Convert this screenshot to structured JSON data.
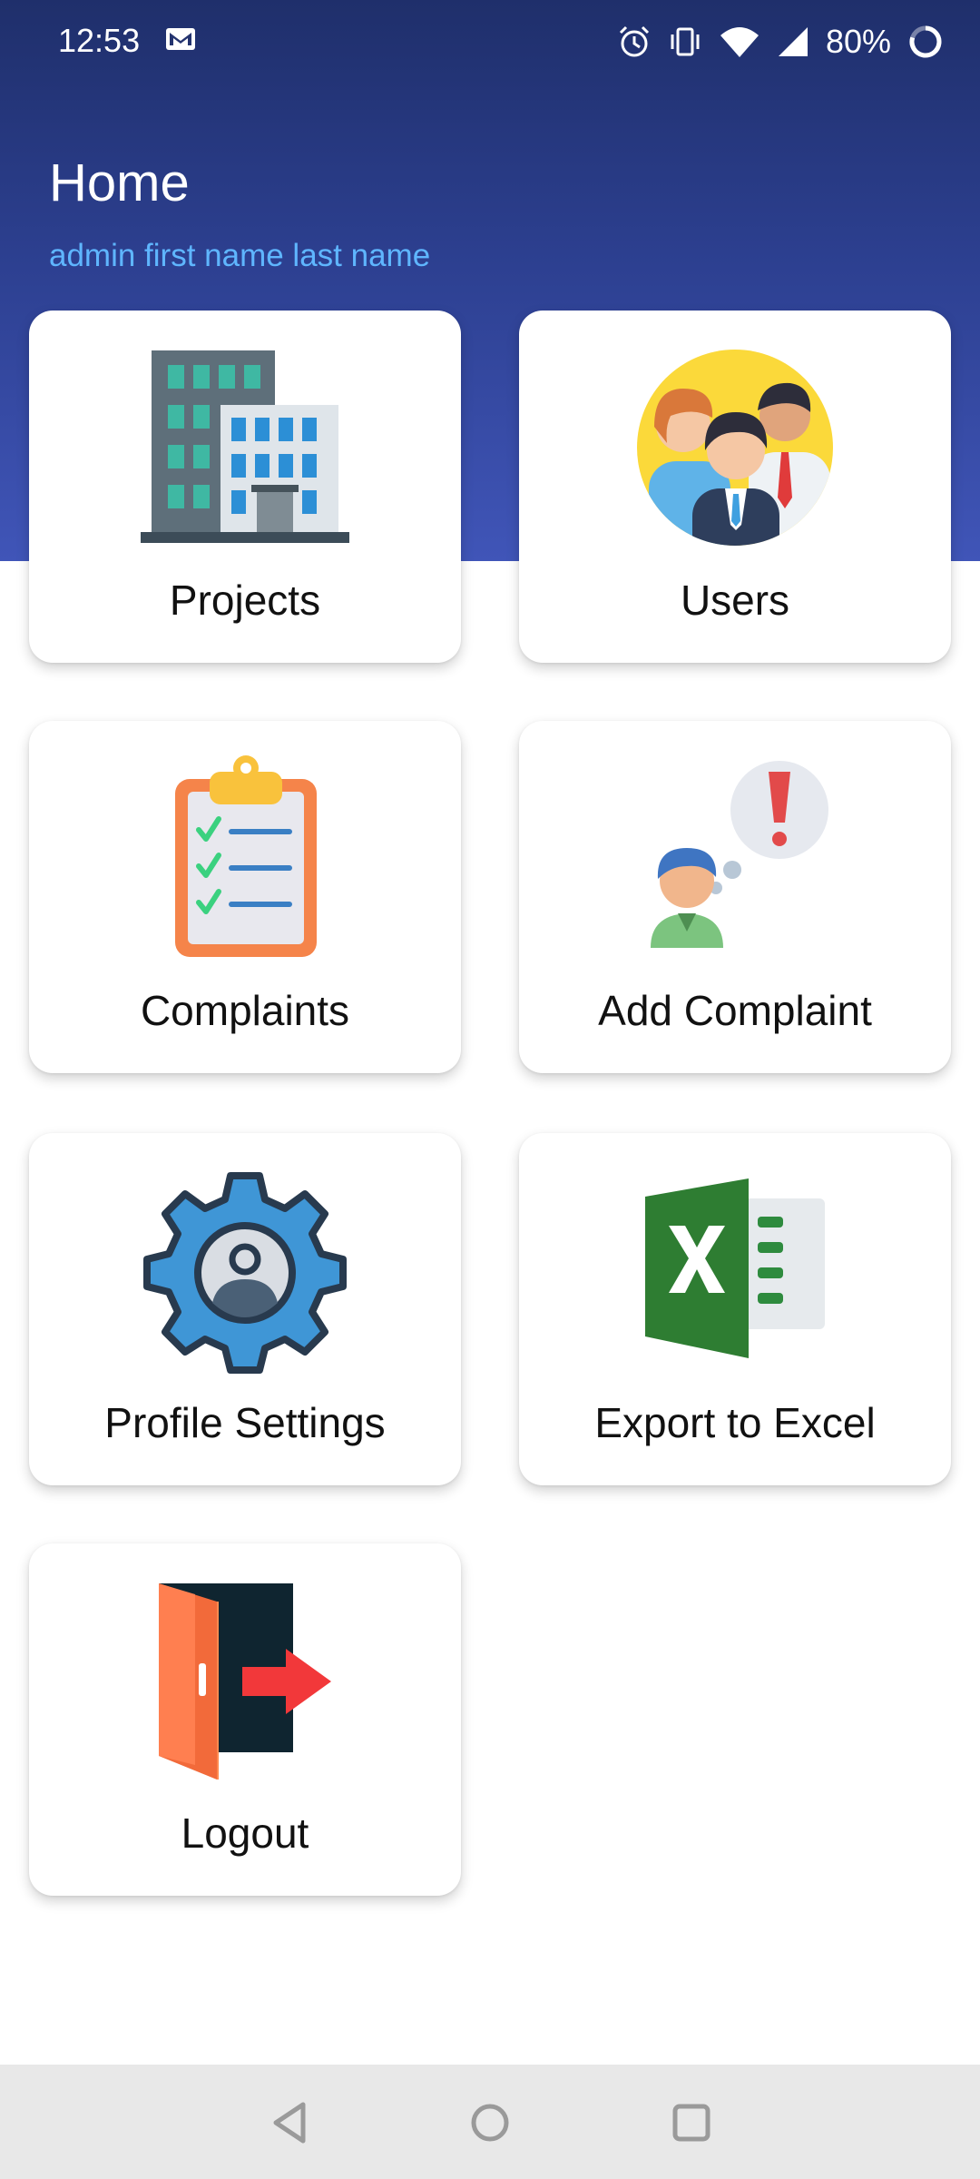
{
  "status_bar": {
    "time": "12:53",
    "battery_percent": "80%",
    "icons": [
      "mail-icon",
      "alarm-icon",
      "vibrate-icon",
      "wifi-icon",
      "signal-icon",
      "battery-icon"
    ]
  },
  "header": {
    "title": "Home",
    "subtitle": "admin first name last name"
  },
  "menu": {
    "items": [
      {
        "label": "Projects",
        "icon": "building-icon"
      },
      {
        "label": "Users",
        "icon": "users-group-icon"
      },
      {
        "label": "Complaints",
        "icon": "clipboard-checklist-icon"
      },
      {
        "label": "Add Complaint",
        "icon": "person-alert-icon"
      },
      {
        "label": "Profile Settings",
        "icon": "profile-gear-icon"
      },
      {
        "label": "Export to Excel",
        "icon": "excel-icon"
      },
      {
        "label": "Logout",
        "icon": "exit-door-icon"
      }
    ]
  },
  "nav_bar": {
    "icons": [
      "back-icon",
      "home-icon",
      "recents-icon"
    ]
  },
  "colors": {
    "header_top": "#1f2f6b",
    "header_bottom": "#4055b8",
    "subtitle": "#5fb6ff",
    "nav_bar": "#e8e8e8"
  }
}
